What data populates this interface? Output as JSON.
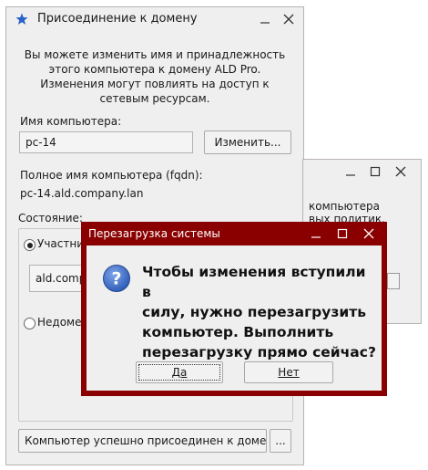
{
  "main_window": {
    "title": "Присоединение к домену",
    "description_line1": "Вы можете изменить имя и принадлежность",
    "description_line2": "этого компьютера к домену ALD Pro.",
    "description_line3": "Изменения могут повлиять на доступ к",
    "description_line4": "сетевым ресурсам.",
    "computer_name_label": "Имя компьютера:",
    "computer_name_value": "pc-14",
    "change_button": "Изменить...",
    "fqdn_label": "Полное имя компьютера (fqdn):",
    "fqdn_value": "pc-14.ald.company.lan",
    "state_label": "Состояние:",
    "member_radio_label": "Участни",
    "domain_field_value": "ald.comp",
    "not_member_radio_label": "Недоме",
    "status_text": "Компьютер успешно присоединен к доме",
    "more_button": "..."
  },
  "back_window": {
    "line1": "компьютера",
    "line2": "вых политик."
  },
  "dialog": {
    "title": "Перезагрузка системы",
    "message_line1": "Чтобы изменения вступили в",
    "message_line2": "силу, нужно перезагрузить",
    "message_line3": "компьютер. Выполнить",
    "message_line4": "перезагрузку прямо сейчас?",
    "yes_button": "Да",
    "no_button": "Нет",
    "icon": "question-icon"
  },
  "colors": {
    "dialog_frame": "#8a0000",
    "app_icon": "#2a62c9",
    "question_icon": "#3d6fd0"
  }
}
